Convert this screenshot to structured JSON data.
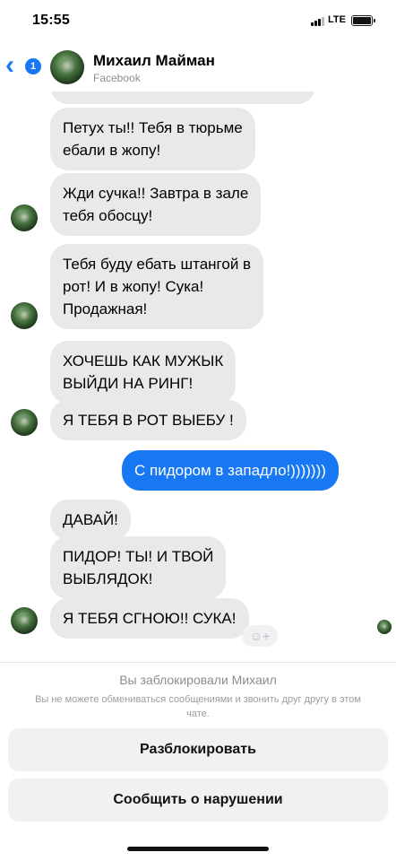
{
  "status_bar": {
    "time": "15:55",
    "network": "LTE",
    "battery_level": 1.0
  },
  "header": {
    "back_badge": "1",
    "contact_name": "Михаил Майман",
    "contact_source": "Facebook"
  },
  "messages": [
    {
      "text": "Петух ты!! Тебя в тюрьме\nебали в жопу!",
      "direction": "received"
    },
    {
      "text": "Жди сучка!! Завтра в зале\nтебя обосцу!",
      "direction": "received"
    },
    {
      "text": "Тебя буду ебать штангой в\nрот! И в жопу! Сука!\nПродажная!",
      "direction": "received"
    },
    {
      "text": "ХОЧЕШЬ КАК МУЖЫК\nВЫЙДИ НА РИНГ!",
      "direction": "received"
    },
    {
      "text": "Я ТЕБЯ В РОТ ВЫЕБУ !",
      "direction": "received"
    },
    {
      "text": "С пидором в западло!)))))))",
      "direction": "sent"
    },
    {
      "text": "ДАВАЙ!",
      "direction": "received"
    },
    {
      "text": "ПИДОР! ТЫ! И ТВОЙ\nВЫБЛЯДОК!",
      "direction": "received"
    },
    {
      "text": "Я ТЕБЯ СГНОЮ!! СУКА!",
      "direction": "received"
    }
  ],
  "blocked": {
    "title": "Вы заблокировали Михаил",
    "subtitle": "Вы не можете обмениваться сообщениями и звонить друг другу в этом чате."
  },
  "actions": {
    "unblock_label": "Разблокировать",
    "report_label": "Сообщить о нарушении"
  },
  "colors": {
    "accent": "#1877f2",
    "bubble_received": "#e9e9eb"
  },
  "icons": {
    "back": "chevron-left-icon",
    "react": "add-reaction-icon"
  }
}
